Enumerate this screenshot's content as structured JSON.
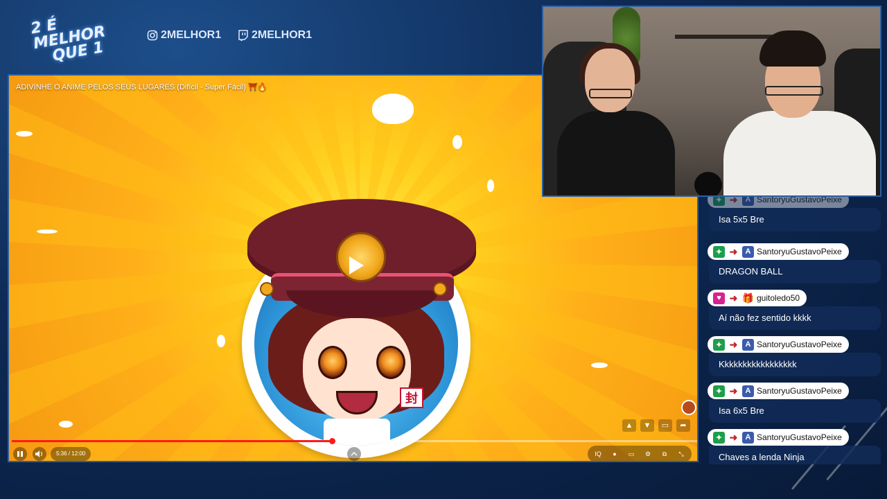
{
  "brand": {
    "logo_line1": "2 É MELHOR",
    "logo_line2": "QUE 1",
    "instagram_handle": "2MELHOR1",
    "twitch_handle": "2MELHOR1",
    "accent_color": "#2b5fa3"
  },
  "player": {
    "title": "ADIVINHE O ANIME PELOS SEUS LUGARES (Difícil - Super Fácil) ⛩️🔥",
    "time_display": "5:36 / 12:00",
    "progress_fraction": 0.467,
    "buffer_fraction": 0.52,
    "progress_color": "#ff1a1a",
    "avatar_seal_text": "封",
    "icons": {
      "play": "play-icon",
      "pause": "pause-icon",
      "volume": "volume-icon",
      "like": "thumbs-up-icon",
      "dislike": "thumbs-down-icon",
      "comment": "comment-icon",
      "share": "share-icon",
      "chapters": "chevron-up-icon",
      "settings": "gear-icon",
      "cast": "cast-icon",
      "fullscreen": "fullscreen-exit-icon"
    },
    "right_controls": [
      "IQ",
      "●",
      "▭",
      "⚙",
      "⧉",
      "⤡"
    ]
  },
  "chat": {
    "messages": [
      {
        "user": "SantoryuGustavoPeixe",
        "badges": [
          "green",
          "fish",
          "blue"
        ],
        "text": "Isa 5x5 Bre"
      },
      {
        "user": "SantoryuGustavoPeixe",
        "badges": [
          "green",
          "fish",
          "blue"
        ],
        "text": "DRAGON BALL"
      },
      {
        "user": "guitoledo50",
        "badges": [
          "pink",
          "fish",
          "gift"
        ],
        "text": "Aí não fez sentido kkkk"
      },
      {
        "user": "SantoryuGustavoPeixe",
        "badges": [
          "green",
          "fish",
          "blue"
        ],
        "text": "Kkkkkkkkkkkkkkkkk"
      },
      {
        "user": "SantoryuGustavoPeixe",
        "badges": [
          "green",
          "fish",
          "blue"
        ],
        "text": "Isa 6x5 Bre"
      },
      {
        "user": "SantoryuGustavoPeixe",
        "badges": [
          "green",
          "fish",
          "blue"
        ],
        "text": "Chaves a lenda Ninja"
      }
    ]
  }
}
